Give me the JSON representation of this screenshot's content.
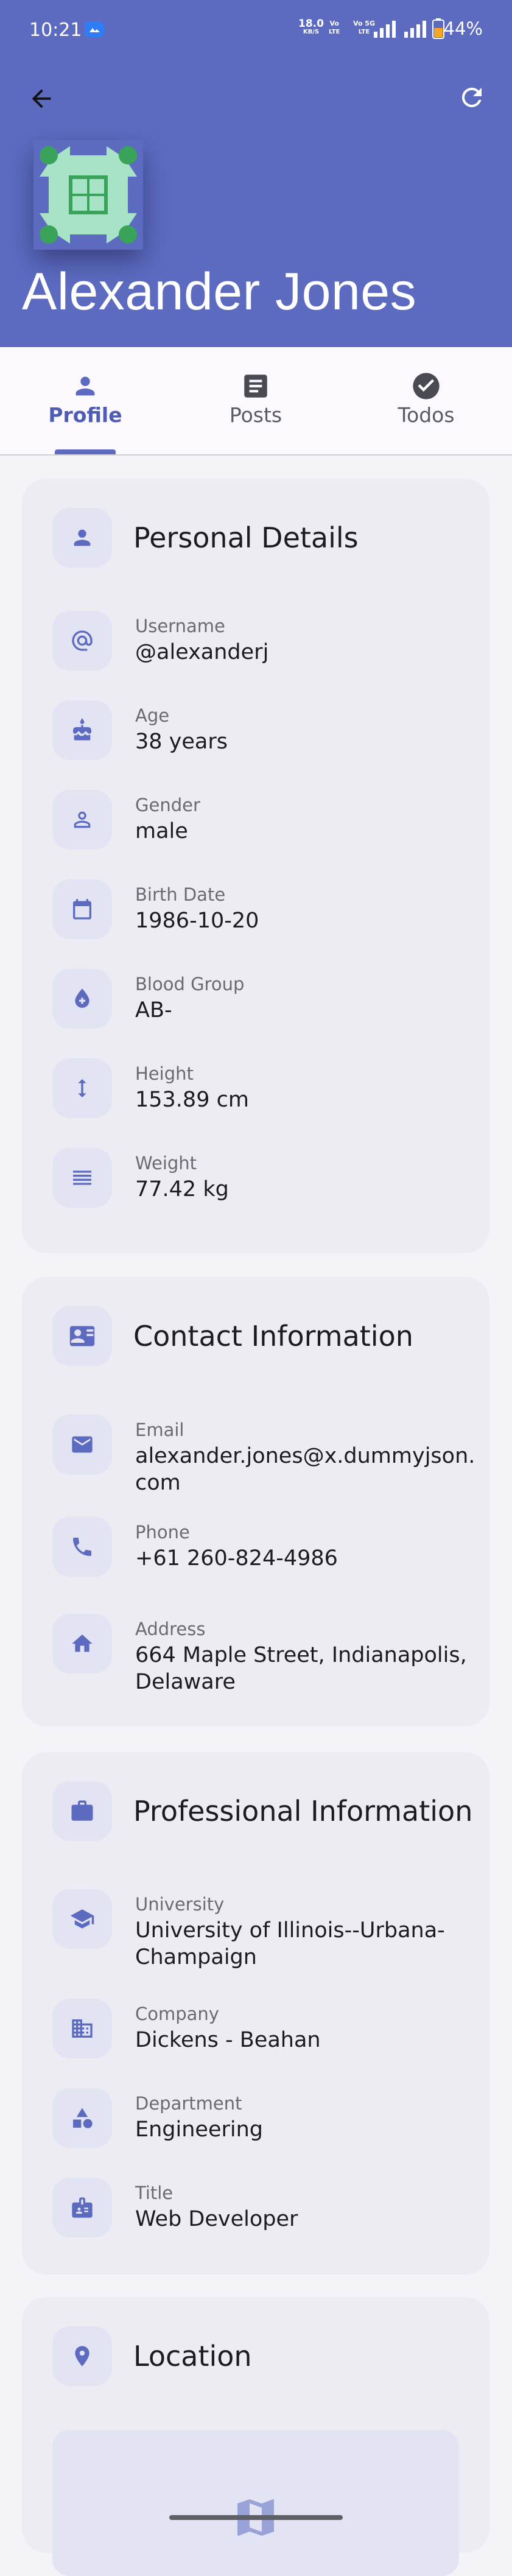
{
  "status_bar": {
    "time": "10:21",
    "net_speed": "18.0",
    "net_unit": "KB/S",
    "volte1": "Vo",
    "volte1_b": "LTE",
    "volte2": "Vo 5G",
    "volte2_b": "LTE",
    "battery": "44%"
  },
  "header": {
    "user_name": "Alexander Jones",
    "colors": {
      "primary": "#5c6bc0",
      "avatar_green": "#3aa35a",
      "avatar_mint": "#a6e3c7"
    }
  },
  "tabs": [
    {
      "label": "Profile",
      "icon": "person-icon",
      "active": true
    },
    {
      "label": "Posts",
      "icon": "article-icon",
      "active": false
    },
    {
      "label": "Todos",
      "icon": "check-circle-icon",
      "active": false
    }
  ],
  "personal": {
    "title": "Personal Details",
    "rows": [
      {
        "label": "Username",
        "value": "@alexanderj",
        "icon": "at-icon"
      },
      {
        "label": "Age",
        "value": "38 years",
        "icon": "cake-icon"
      },
      {
        "label": "Gender",
        "value": "male",
        "icon": "person-outline-icon"
      },
      {
        "label": "Birth Date",
        "value": "1986-10-20",
        "icon": "calendar-icon"
      },
      {
        "label": "Blood Group",
        "value": "AB-",
        "icon": "blood-drop-icon"
      },
      {
        "label": "Height",
        "value": "153.89 cm",
        "icon": "height-icon"
      },
      {
        "label": "Weight",
        "value": "77.42 kg",
        "icon": "weight-icon"
      }
    ]
  },
  "contact": {
    "title": "Contact Information",
    "rows": [
      {
        "label": "Email",
        "value_line1": "alexander.jones@x.dummyjson.",
        "value_line2": "com",
        "icon": "mail-icon"
      },
      {
        "label": "Phone",
        "value_line1": "+61 260-824-4986",
        "value_line2": "",
        "icon": "phone-icon"
      },
      {
        "label": "Address",
        "value_line1": "664 Maple Street, Indianapolis,",
        "value_line2": "Delaware",
        "icon": "home-icon"
      }
    ]
  },
  "professional": {
    "title": "Professional Information",
    "rows": [
      {
        "label": "University",
        "value_line1": "University of Illinois--Urbana-",
        "value_line2": "Champaign",
        "icon": "school-icon"
      },
      {
        "label": "Company",
        "value_line1": "Dickens - Beahan",
        "value_line2": "",
        "icon": "business-icon"
      },
      {
        "label": "Department",
        "value_line1": "Engineering",
        "value_line2": "",
        "icon": "category-icon"
      },
      {
        "label": "Title",
        "value_line1": "Web Developer",
        "value_line2": "",
        "icon": "badge-icon"
      }
    ]
  },
  "location": {
    "title": "Location",
    "icon": "location-pin-icon"
  }
}
